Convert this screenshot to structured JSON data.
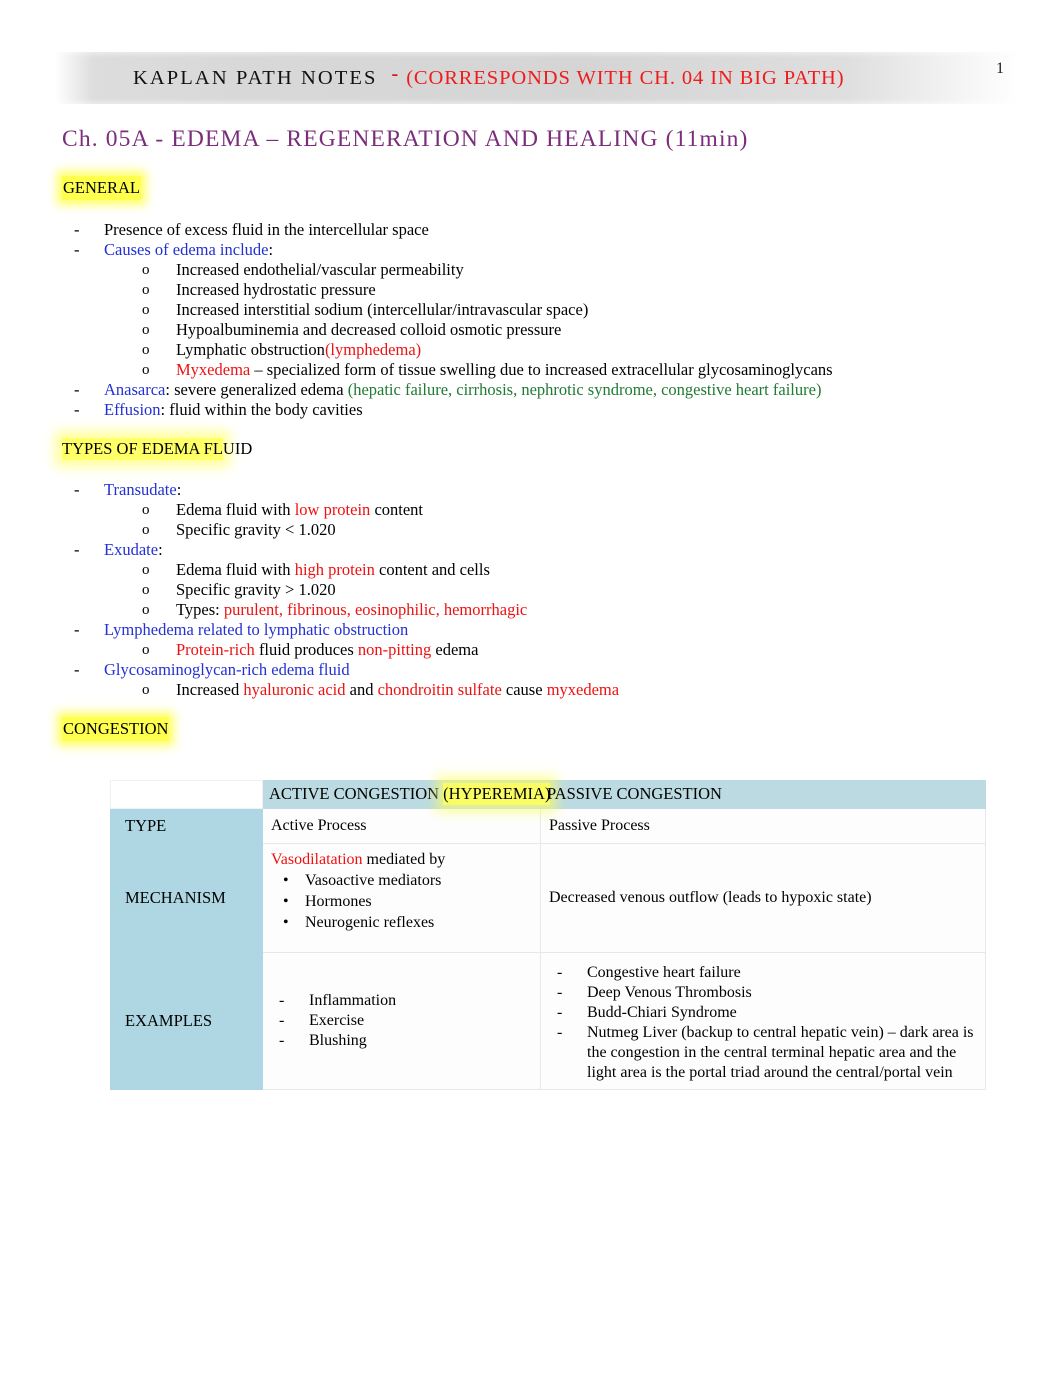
{
  "header": {
    "title": "KAPLAN PATH NOTES",
    "dash": "-",
    "subtitle": "(CORRESPONDS WITH CH. 04 IN BIG PATH)",
    "page_number": "1",
    "band_color": "#d5d5d5",
    "subtitle_color": "#ee1c1c"
  },
  "doc_title": {
    "text": "Ch. 05A - EDEMA – REGENERATION AND HEALING (11min)",
    "color": "#7b2d7b"
  },
  "colors": {
    "highlight": "#ffff4d",
    "blue_term": "#2330d4",
    "red_term": "#ee1111",
    "green_term": "#1f7a32",
    "table_header_fill": "#bcdae2",
    "table_rowhead_fill": "#aed7e3"
  },
  "sections": {
    "general": {
      "heading": "GENERAL",
      "items": [
        {
          "marker": "-",
          "level": 1,
          "parts": [
            {
              "t": "Presence of excess fluid in the intercellular space",
              "c": "black"
            }
          ]
        },
        {
          "marker": "-",
          "level": 1,
          "parts": [
            {
              "t": "Causes of edema include",
              "c": "blue"
            },
            {
              "t": ":",
              "c": "black"
            }
          ]
        },
        {
          "marker": "o",
          "level": 2,
          "parts": [
            {
              "t": "Increased endothelial/vascular permeability",
              "c": "black"
            }
          ]
        },
        {
          "marker": "o",
          "level": 2,
          "parts": [
            {
              "t": "Increased hydrostatic pressure",
              "c": "black"
            }
          ]
        },
        {
          "marker": "o",
          "level": 2,
          "parts": [
            {
              "t": "Increased interstitial sodium (intercellular/intravascular space)",
              "c": "black"
            }
          ]
        },
        {
          "marker": "o",
          "level": 2,
          "parts": [
            {
              "t": "Hypoalbuminemia and decreased colloid osmotic pressure",
              "c": "black"
            }
          ]
        },
        {
          "marker": "o",
          "level": 2,
          "parts": [
            {
              "t": "Lymphatic obstruction",
              "c": "black"
            },
            {
              "t": "(lymphedema)",
              "c": "red"
            }
          ]
        },
        {
          "marker": "o",
          "level": 2,
          "parts": [
            {
              "t": "Myxedema",
              "c": "red"
            },
            {
              "t": " – specialized form of tissue swelling due to increased extracellular glycosaminoglycans",
              "c": "black"
            }
          ]
        },
        {
          "marker": "-",
          "level": 1,
          "parts": [
            {
              "t": "Anasarca",
              "c": "blue"
            },
            {
              "t": ":  severe generalized edema ",
              "c": "black"
            },
            {
              "t": "(hepatic failure, cirrhosis, nephrotic syndrome, congestive heart failure)",
              "c": "green"
            }
          ]
        },
        {
          "marker": "-",
          "level": 1,
          "parts": [
            {
              "t": "Effusion",
              "c": "blue"
            },
            {
              "t": ":  fluid within the body cavities",
              "c": "black"
            }
          ]
        }
      ]
    },
    "types_of_edema_fluid": {
      "heading_highlighted": "TYPES OF EDEMA FL",
      "heading_plain": "UID",
      "items": [
        {
          "marker": "-",
          "level": 1,
          "parts": [
            {
              "t": "Transudate",
              "c": "blue"
            },
            {
              "t": ":",
              "c": "black"
            }
          ]
        },
        {
          "marker": "o",
          "level": 2,
          "parts": [
            {
              "t": "Edema fluid with ",
              "c": "black"
            },
            {
              "t": "low protein",
              "c": "red"
            },
            {
              "t": " content",
              "c": "black"
            }
          ]
        },
        {
          "marker": "o",
          "level": 2,
          "parts": [
            {
              "t": "Specific gravity < 1.020",
              "c": "black"
            }
          ]
        },
        {
          "marker": "-",
          "level": 1,
          "parts": [
            {
              "t": "Exudate",
              "c": "blue"
            },
            {
              "t": ":",
              "c": "black"
            }
          ]
        },
        {
          "marker": "o",
          "level": 2,
          "parts": [
            {
              "t": "Edema fluid with ",
              "c": "black"
            },
            {
              "t": "high protein",
              "c": "red"
            },
            {
              "t": " content and cells",
              "c": "black"
            }
          ]
        },
        {
          "marker": "o",
          "level": 2,
          "parts": [
            {
              "t": "Specific gravity > 1.020",
              "c": "black"
            }
          ]
        },
        {
          "marker": "o",
          "level": 2,
          "parts": [
            {
              "t": "Types: ",
              "c": "black"
            },
            {
              "t": "purulent, fibrinous, eosinophilic, hemorrhagic",
              "c": "red"
            }
          ]
        },
        {
          "marker": "-",
          "level": 1,
          "parts": [
            {
              "t": "Lymphedema related to lymphatic obstruction",
              "c": "blue"
            }
          ]
        },
        {
          "marker": "o",
          "level": 2,
          "parts": [
            {
              "t": "Protein-rich",
              "c": "red"
            },
            {
              "t": " fluid produces ",
              "c": "black"
            },
            {
              "t": "non-pitting",
              "c": "red"
            },
            {
              "t": " edema",
              "c": "black"
            }
          ]
        },
        {
          "marker": "-",
          "level": 1,
          "parts": [
            {
              "t": "Glycosaminoglycan-rich edema fluid",
              "c": "blue"
            }
          ]
        },
        {
          "marker": "o",
          "level": 2,
          "parts": [
            {
              "t": "Increased ",
              "c": "black"
            },
            {
              "t": "hyaluronic acid",
              "c": "red"
            },
            {
              "t": " and ",
              "c": "black"
            },
            {
              "t": "chondroitin sulfate",
              "c": "red"
            },
            {
              "t": " cause ",
              "c": "black"
            },
            {
              "t": "myxedema",
              "c": "red"
            }
          ]
        }
      ]
    },
    "congestion": {
      "heading": "CONGESTION",
      "table": {
        "col_headers": {
          "corner": "",
          "active_prefix": "ACTIVE CONGESTION ",
          "active_highlight": "(HYPEREMIA)",
          "passive": "PASSIVE CONGESTION"
        },
        "rows": [
          {
            "label": "TYPE",
            "active": {
              "lead": "Active Process"
            },
            "passive": {
              "lead": "Passive Process"
            }
          },
          {
            "label": "MECHANISM",
            "active": {
              "lead_red": "Vasodilatation",
              "lead_rest": " mediated by",
              "bullets": [
                "Vasoactive mediators",
                "Hormones",
                "Neurogenic reflexes"
              ]
            },
            "passive": {
              "lead": "Decreased venous outflow (leads to hypoxic state)"
            }
          },
          {
            "label": "EXAMPLES",
            "active": {
              "bullets": [
                "Inflammation",
                "Exercise",
                "Blushing"
              ]
            },
            "passive": {
              "bullets": [
                "Congestive heart failure",
                "Deep Venous Thrombosis",
                "Budd-Chiari Syndrome",
                "Nutmeg Liver (backup to central hepatic vein) – dark area is the congestion in the central terminal hepatic area and the light area is the portal triad around the central/portal vein"
              ]
            }
          }
        ]
      }
    }
  }
}
